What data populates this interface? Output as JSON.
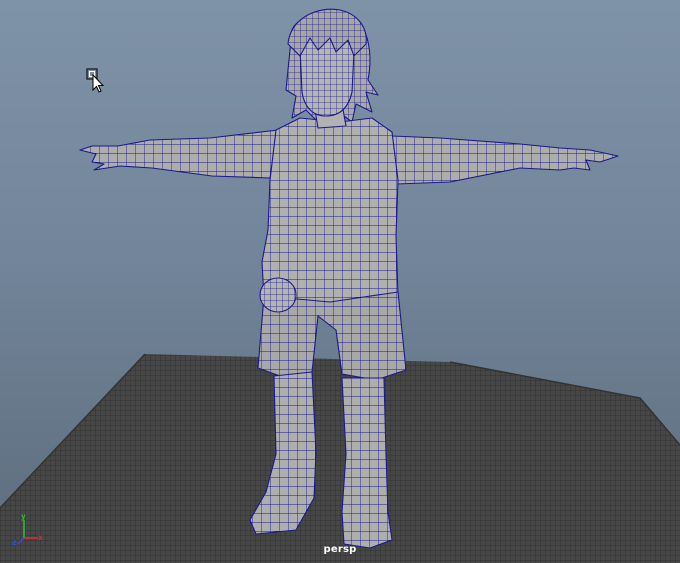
{
  "viewport": {
    "camera_label": "persp",
    "axes": {
      "x": "x",
      "y": "y",
      "z": "z"
    }
  },
  "colors": {
    "background_top": "#7f93a8",
    "background_bottom": "#5d6c7c",
    "grid_fill": "#464646",
    "grid_lines": "#2c2c2c",
    "mesh_fill": "#aeaeaf",
    "wireframe": "#1a1a8c",
    "axis_x": "#e03030",
    "axis_y": "#30c030",
    "axis_z": "#3050e0"
  },
  "icons": {
    "cursor": "arrow-cursor-icon"
  }
}
